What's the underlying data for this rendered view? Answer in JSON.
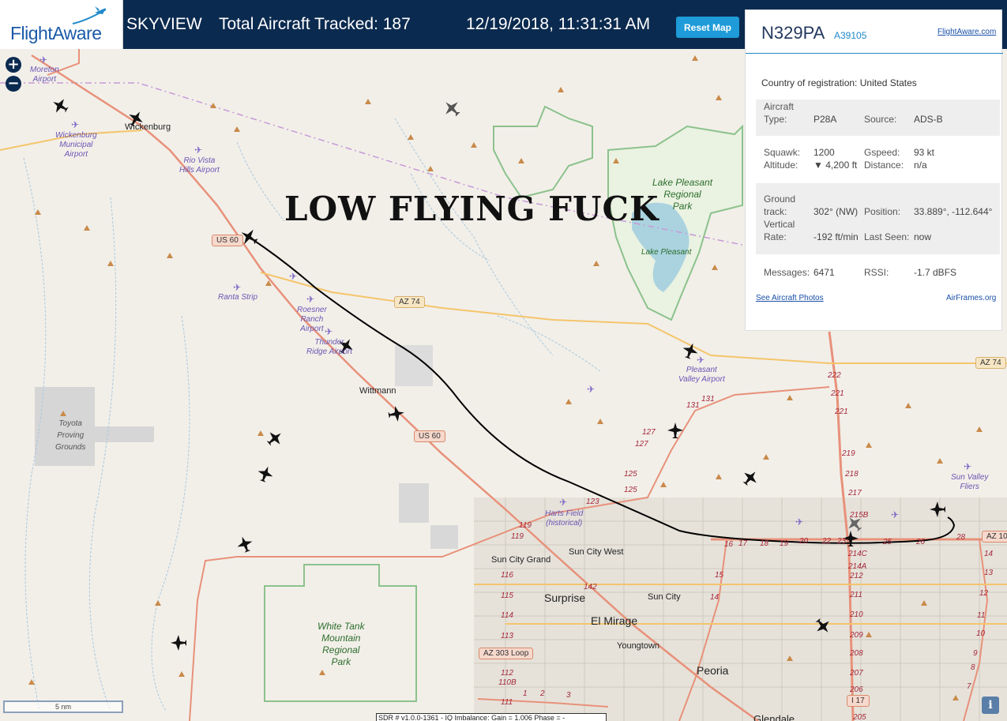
{
  "header": {
    "logo_text": "FlightAware",
    "app_name": "SKYVIEW",
    "total_tracked": "Total Aircraft Tracked: 187",
    "datetime": "12/19/2018, 11:31:31 AM",
    "reset_button": "Reset Map"
  },
  "map_controls": {
    "zoom_in": "+",
    "zoom_out": "−"
  },
  "overlay_text": "LOW FLYING FUCK",
  "panel": {
    "registration": "N329PA",
    "hex": "A39105",
    "fa_link": "FlightAware.com",
    "country_label": "Country of registration:",
    "country_value": "United States",
    "aircraft_type_label": "Aircraft Type:",
    "aircraft_type_value": "P28A",
    "source_label": "Source:",
    "source_value": "ADS-B",
    "squawk_label": "Squawk:",
    "squawk_value": "1200",
    "gspeed_label": "Gspeed:",
    "gspeed_value": "93 kt",
    "altitude_label": "Altitude:",
    "altitude_value": "▼ 4,200 ft",
    "distance_label": "Distance:",
    "distance_value": "n/a",
    "ground_track_label": "Ground track:",
    "ground_track_value": "302° (NW)",
    "position_label": "Position:",
    "position_value": "33.889°, -112.644°",
    "vertical_rate_label": "Vertical Rate:",
    "vertical_rate_value": "-192 ft/min",
    "last_seen_label": "Last Seen:",
    "last_seen_value": "now",
    "messages_label": "Messages:",
    "messages_value": "6471",
    "rssi_label": "RSSI:",
    "rssi_value": "-1.7 dBFS",
    "photos_link": "See Aircraft Photos",
    "airframes_link": "AirFrames.org"
  },
  "map": {
    "places": {
      "wickenburg": "Wickenburg",
      "wittmann": "Wittmann",
      "sun_city_grand": "Sun City Grand",
      "sun_city_west": "Sun City West",
      "surprise": "Surprise",
      "sun_city": "Sun City",
      "el_mirage": "El Mirage",
      "youngtown": "Youngtown",
      "peoria": "Peoria",
      "glendale": "Glendale",
      "toyota": "Toyota\nProving\nGrounds"
    },
    "airports": {
      "moreton": "Moreton\nAirport",
      "wickenburg_muni": "Wickenburg\nMunicipal\nAirport",
      "rio_vista": "Rio Vista\nHills Airport",
      "ranta": "Ranta Strip",
      "roesner": "Roesner\nRanch\nAirport",
      "thunder": "Thunder\nRidge Airport",
      "pleasant_valley": "Pleasant\nValley Airport",
      "harts": "Harts Field\n(historical)",
      "sun_valley": "Sun Valley\nFliers"
    },
    "parks": {
      "lake_pleasant_park": "Lake Pleasant\nRegional\nPark",
      "lake_pleasant": "Lake Pleasant",
      "white_tank": "White Tank\nMountain\nRegional\nPark"
    },
    "shields": {
      "us60_a": "US 60",
      "us60_b": "US 60",
      "az74_a": "AZ 74",
      "az74_b": "AZ 74",
      "az303": "AZ 303 Loop",
      "i17": "I 17",
      "az101": "AZ 10"
    },
    "route_numbers": [
      "119",
      "119",
      "123",
      "125",
      "127",
      "127",
      "125",
      "131",
      "131",
      "142",
      "116",
      "115",
      "114",
      "113",
      "112",
      "110B",
      "111",
      "1",
      "2",
      "3",
      "17",
      "16",
      "18",
      "19",
      "20",
      "22",
      "23",
      "215B",
      "214C",
      "214A",
      "212",
      "211",
      "210",
      "209",
      "208",
      "207",
      "206",
      "205",
      "25",
      "26",
      "28",
      "222",
      "221",
      "221",
      "219",
      "218",
      "217",
      "14",
      "13",
      "12",
      "11",
      "10",
      "9",
      "8",
      "7",
      "15",
      "14"
    ]
  },
  "bottom": {
    "scale": "5 nm",
    "sdr_text": "SDR # v1.0.0-1361 - IQ Imbalance: Gain = 1.006 Phase = -",
    "info_button": "i"
  },
  "colors": {
    "header_bg": "#0b2a4f",
    "button_blue": "#1e9bd8",
    "map_bg": "#f2efe9",
    "highway": "#e8917a",
    "state_road": "#f4c56b",
    "park_border": "#8cc28c",
    "water": "#aad3df",
    "track_line": "#000000"
  }
}
